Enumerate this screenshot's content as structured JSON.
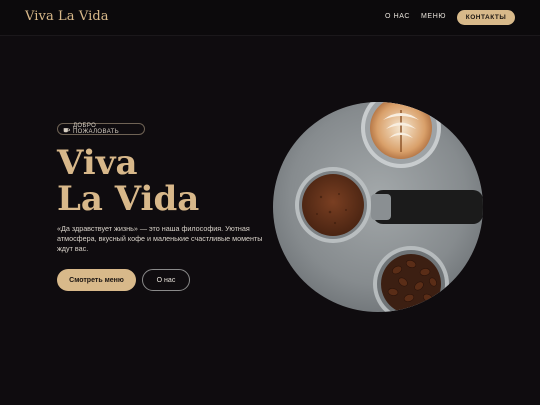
{
  "brand": {
    "name": "Viva La Vida"
  },
  "nav": {
    "about": "О НАС",
    "menu": "МЕНЮ",
    "contacts": "КОНТАКТЫ"
  },
  "hero": {
    "badge": "ДОБРО ПОЖАЛОВАТЬ",
    "badge_icon": "coffee-cup-icon",
    "title_line1": "Viva",
    "title_line2": "La Vida",
    "description": "«Да здравствует жизнь» — это наша философия. Уютная атмосфера, вкусный кофе и маленькие счастливые моменты ждут вас.",
    "primary_button": "Смотреть меню",
    "secondary_button": "О нас",
    "image_subject": "coffee-photo"
  },
  "colors": {
    "background": "#0f0c0f",
    "accent": "#d8b98a",
    "text": "#e9e4dc"
  }
}
